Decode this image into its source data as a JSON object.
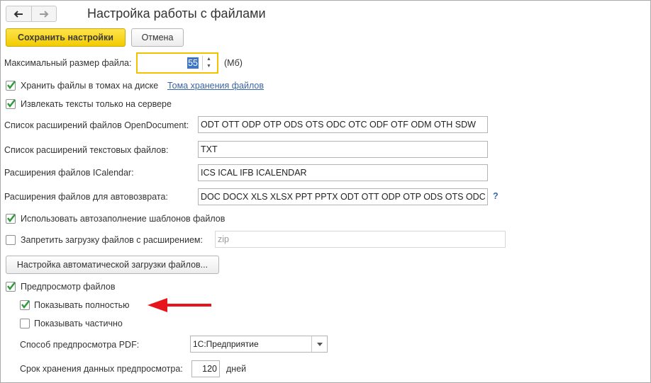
{
  "window": {
    "title": "Настройка работы с файлами"
  },
  "toolbar": {
    "save_label": "Сохранить настройки",
    "cancel_label": "Отмена"
  },
  "max_size": {
    "label": "Максимальный размер файла:",
    "value": "55",
    "unit": "(Мб)"
  },
  "store_volumes": {
    "label": "Хранить файлы в томах на диске",
    "checked": true,
    "link": "Тома хранения файлов"
  },
  "extract_server": {
    "label": "Извлекать тексты только на сервере",
    "checked": true
  },
  "opendoc": {
    "label": "Список расширений файлов OpenDocument:",
    "value": "ODT OTT ODP OTP ODS OTS ODC OTC ODF OTF ODM OTH SDW"
  },
  "text_ext": {
    "label": "Список расширений текстовых файлов:",
    "value": "TXT"
  },
  "icalendar": {
    "label": "Расширения файлов ICalendar:",
    "value": "ICS ICAL IFB ICALENDAR"
  },
  "autoreturn": {
    "label": "Расширения файлов для автовозврата:",
    "value": "DOC DOCX XLS XLSX PPT PPTX ODT OTT ODP OTP ODS OTS ODC",
    "help": "?"
  },
  "autofill": {
    "label": "Использовать автозаполнение шаблонов файлов",
    "checked": true
  },
  "forbid": {
    "label": "Запретить загрузку файлов с расширением:",
    "checked": false,
    "value": "zip"
  },
  "auto_upload_button": "Настройка автоматической загрузки файлов...",
  "preview": {
    "label": "Предпросмотр файлов",
    "checked": true
  },
  "show_full": {
    "label": "Показывать полностью",
    "checked": true
  },
  "show_partial": {
    "label": "Показывать частично",
    "checked": false
  },
  "pdf_method": {
    "label": "Способ предпросмотра PDF:",
    "value": "1С:Предприятие"
  },
  "retention": {
    "label": "Срок хранения данных предпросмотра:",
    "value": "120",
    "unit": "дней"
  },
  "colors": {
    "accent": "#f2cc00",
    "link": "#3a64a8",
    "check": "#2f9a3a",
    "arrow": "#e8141b"
  },
  "icons": {
    "back": "arrow-left",
    "forward": "arrow-right",
    "check": "checkmark",
    "annotation": "red-arrow"
  }
}
